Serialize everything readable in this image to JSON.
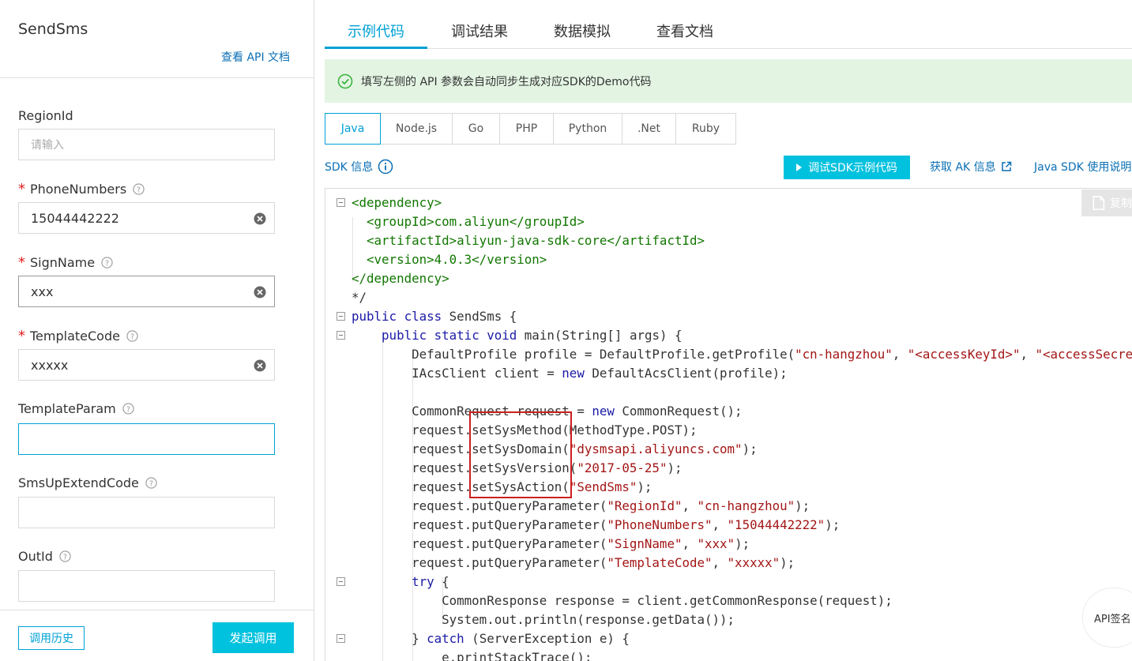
{
  "left": {
    "api_name": "SendSms",
    "doc_link": "查看 API 文档",
    "fields": [
      {
        "label": "RegionId",
        "required": false,
        "help": false,
        "value": "",
        "placeholder": "请输入"
      },
      {
        "label": "PhoneNumbers",
        "required": true,
        "help": true,
        "value": "15044442222"
      },
      {
        "label": "SignName",
        "required": true,
        "help": true,
        "value": "xxx"
      },
      {
        "label": "TemplateCode",
        "required": true,
        "help": true,
        "value": "xxxxx"
      },
      {
        "label": "TemplateParam",
        "required": false,
        "help": true,
        "value": ""
      },
      {
        "label": "SmsUpExtendCode",
        "required": false,
        "help": true,
        "value": ""
      },
      {
        "label": "OutId",
        "required": false,
        "help": true,
        "value": ""
      }
    ],
    "required_mark": "*",
    "history_button": "调用历史",
    "invoke_button": "发起调用"
  },
  "tabs": [
    "示例代码",
    "调试结果",
    "数据模拟",
    "查看文档"
  ],
  "active_tab": "示例代码",
  "notice": "填写左侧的 API 参数会自动同步生成对应SDK的Demo代码",
  "languages": [
    "Java",
    "Node.js",
    "Go",
    "PHP",
    "Python",
    ".Net",
    "Ruby"
  ],
  "active_language": "Java",
  "toolbar": {
    "sdk_info": "SDK 信息",
    "debug_button": "调试SDK示例代码",
    "ak_link": "获取 AK 信息",
    "sdk_doc_link": "Java SDK 使用说明"
  },
  "copy_button": "复制",
  "sign_button": "API签名",
  "code_lines": [
    "<dependency>",
    "  <groupId>com.aliyun</groupId>",
    "  <artifactId>aliyun-java-sdk-core</artifactId>",
    "  <version>4.0.3</version>",
    "</dependency>",
    "*/",
    "public class SendSms {",
    "    public static void main(String[] args) {",
    "        DefaultProfile profile = DefaultProfile.getProfile(\"cn-hangzhou\", \"<accessKeyId>\", \"<accessSecret>\");",
    "        IAcsClient client = new DefaultAcsClient(profile);",
    "",
    "        CommonRequest request = new CommonRequest();",
    "        request.setSysMethod(MethodType.POST);",
    "        request.setSysDomain(\"dysmsapi.aliyuncs.com\");",
    "        request.setSysVersion(\"2017-05-25\");",
    "        request.setSysAction(\"SendSms\");",
    "        request.putQueryParameter(\"RegionId\", \"cn-hangzhou\");",
    "        request.putQueryParameter(\"PhoneNumbers\", \"15044442222\");",
    "        request.putQueryParameter(\"SignName\", \"xxx\");",
    "        request.putQueryParameter(\"TemplateCode\", \"xxxxx\");",
    "        try {",
    "            CommonResponse response = client.getCommonResponse(request);",
    "            System.out.println(response.getData());",
    "        } catch (ServerException e) {",
    "            e.printStackTrace();"
  ],
  "colors": {
    "accent": "#00a1d6",
    "primary_button": "#00c1de",
    "link": "#0a6fb5",
    "required": "#e02020",
    "highlight_box": "#c9201e",
    "notice_bg": "#e3f4e3"
  }
}
